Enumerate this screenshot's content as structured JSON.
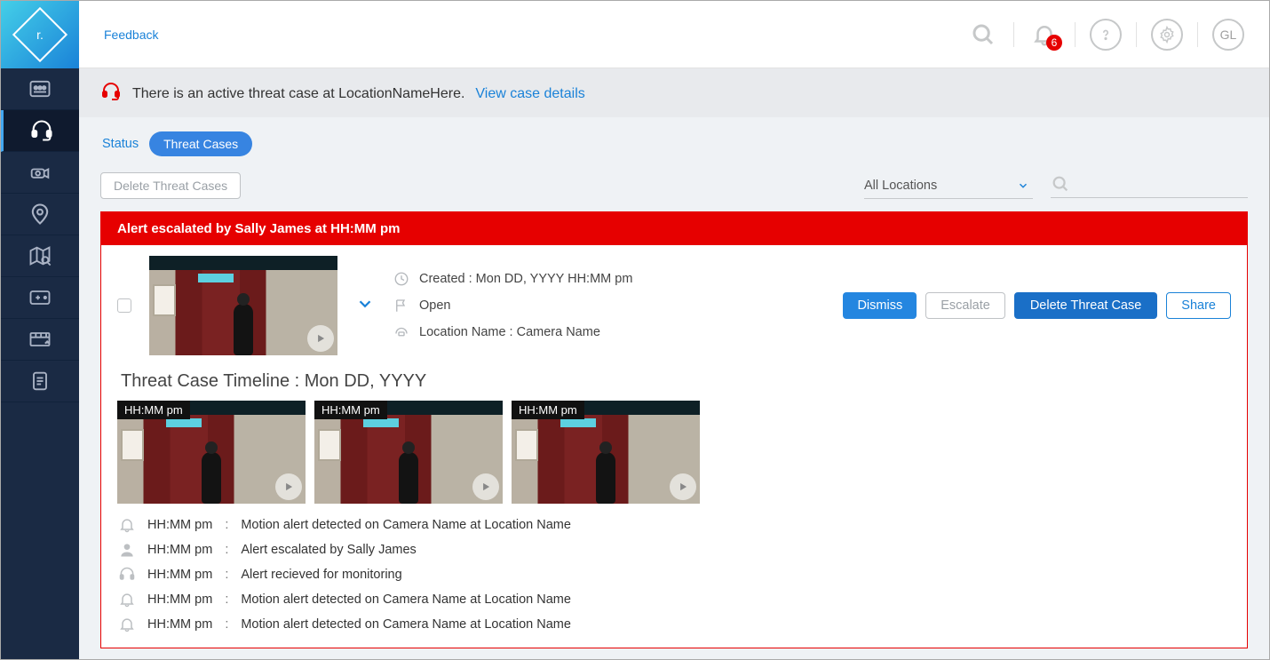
{
  "topbar": {
    "feedback": "Feedback",
    "notification_count": "6",
    "avatar_initials": "GL"
  },
  "banner": {
    "text": "There is an active threat case at LocationNameHere.",
    "link": "View case details"
  },
  "tabs": {
    "status": "Status",
    "threat_cases": "Threat Cases"
  },
  "toolbar": {
    "delete_btn": "Delete Threat Cases",
    "location_filter": "All Locations",
    "search_placeholder": ""
  },
  "case": {
    "banner": "Alert escalated by Sally James at HH:MM pm",
    "created": "Created : Mon DD, YYYY  HH:MM pm",
    "status": "Open",
    "location": "Location Name  :  Camera Name",
    "actions": {
      "dismiss": "Dismiss",
      "escalate": "Escalate",
      "delete": "Delete Threat Case",
      "share": "Share"
    }
  },
  "timeline": {
    "title": "Threat Case Timeline  :  Mon DD, YYYY",
    "thumbs": [
      {
        "ts": "HH:MM pm"
      },
      {
        "ts": "HH:MM pm"
      },
      {
        "ts": "HH:MM pm"
      }
    ],
    "log": [
      {
        "icon": "bell",
        "time": "HH:MM pm",
        "text": "Motion alert detected on Camera Name at Location Name"
      },
      {
        "icon": "person",
        "time": "HH:MM pm",
        "text": "Alert escalated by Sally James"
      },
      {
        "icon": "headset",
        "time": "HH:MM pm",
        "text": "Alert recieved for monitoring"
      },
      {
        "icon": "bell",
        "time": "HH:MM pm",
        "text": "Motion alert detected on Camera Name at Location Name"
      },
      {
        "icon": "bell",
        "time": "HH:MM pm",
        "text": "Motion alert detected on Camera Name at Location Name"
      }
    ]
  }
}
